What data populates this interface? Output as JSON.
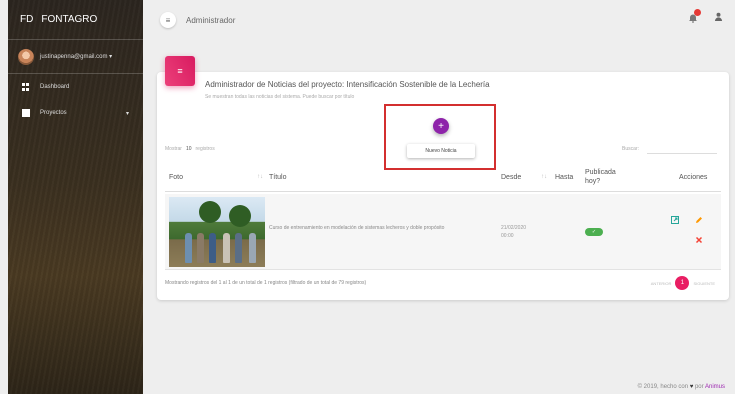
{
  "sidebar": {
    "brand_short": "FD",
    "brand_name": "FONTAGRO",
    "user_email": "justinapenna@gmail.com ▾",
    "items": [
      {
        "label": "Dashboard"
      },
      {
        "label": "Proyectos",
        "caret": "▾"
      }
    ]
  },
  "topbar": {
    "menu_icon": "≡",
    "title": "Administrador",
    "notif_icon": "bell",
    "user_icon": "person"
  },
  "card": {
    "icon": "≡",
    "title": "Administrador de Noticias del proyecto: Intensificación Sostenible de la Lechería",
    "subtitle": "Se muestran todas las noticias del sistema. Puede buscar por título",
    "add_button": "+",
    "add_tooltip": "Nuevo Noticia",
    "show_prefix": "Mostrar",
    "show_value": "10",
    "show_suffix": "registros",
    "search_label": "Buscar:",
    "columns": {
      "foto": "Foto",
      "titulo": "Título",
      "desde": "Desde",
      "hasta": "Hasta",
      "publicada": "Publicada hoy?",
      "acciones": "Acciones"
    },
    "rows": [
      {
        "titulo": "Curso de entrenamiento en modelación de sistemas lecheros y doble propósito",
        "desde_fecha": "21/02/2020",
        "desde_hora": "00:00",
        "publicada": "✓"
      }
    ],
    "footer_text": "Mostrando registros del 1 al 1 de un total de 1 registros (filtrado de un total de 79 registros)",
    "pager": {
      "prev": "ANTERIOR",
      "current": "1",
      "next": "SIGUIENTE"
    }
  },
  "footer": {
    "prefix": "© 2019, hecho con",
    "heart": "♥",
    "mid": "por",
    "brand": "Animus"
  },
  "colors": {
    "accent": "#8e24aa",
    "card_icon": "#d81b60",
    "highlight": "#d32f2f",
    "success": "#4caf50"
  }
}
